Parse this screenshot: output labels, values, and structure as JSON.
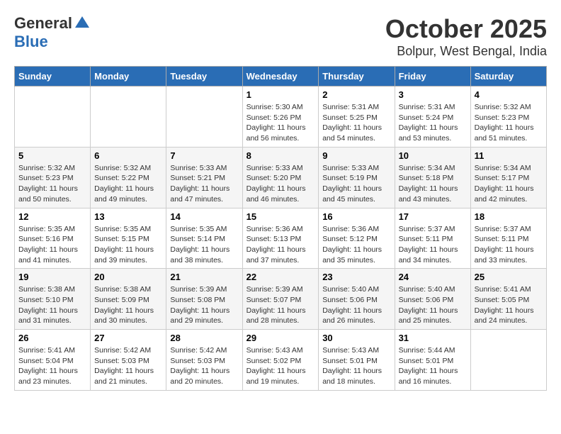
{
  "logo": {
    "general": "General",
    "blue": "Blue"
  },
  "title": {
    "month": "October 2025",
    "location": "Bolpur, West Bengal, India"
  },
  "headers": [
    "Sunday",
    "Monday",
    "Tuesday",
    "Wednesday",
    "Thursday",
    "Friday",
    "Saturday"
  ],
  "weeks": [
    [
      {
        "day": "",
        "info": ""
      },
      {
        "day": "",
        "info": ""
      },
      {
        "day": "",
        "info": ""
      },
      {
        "day": "1",
        "info": "Sunrise: 5:30 AM\nSunset: 5:26 PM\nDaylight: 11 hours\nand 56 minutes."
      },
      {
        "day": "2",
        "info": "Sunrise: 5:31 AM\nSunset: 5:25 PM\nDaylight: 11 hours\nand 54 minutes."
      },
      {
        "day": "3",
        "info": "Sunrise: 5:31 AM\nSunset: 5:24 PM\nDaylight: 11 hours\nand 53 minutes."
      },
      {
        "day": "4",
        "info": "Sunrise: 5:32 AM\nSunset: 5:23 PM\nDaylight: 11 hours\nand 51 minutes."
      }
    ],
    [
      {
        "day": "5",
        "info": "Sunrise: 5:32 AM\nSunset: 5:23 PM\nDaylight: 11 hours\nand 50 minutes."
      },
      {
        "day": "6",
        "info": "Sunrise: 5:32 AM\nSunset: 5:22 PM\nDaylight: 11 hours\nand 49 minutes."
      },
      {
        "day": "7",
        "info": "Sunrise: 5:33 AM\nSunset: 5:21 PM\nDaylight: 11 hours\nand 47 minutes."
      },
      {
        "day": "8",
        "info": "Sunrise: 5:33 AM\nSunset: 5:20 PM\nDaylight: 11 hours\nand 46 minutes."
      },
      {
        "day": "9",
        "info": "Sunrise: 5:33 AM\nSunset: 5:19 PM\nDaylight: 11 hours\nand 45 minutes."
      },
      {
        "day": "10",
        "info": "Sunrise: 5:34 AM\nSunset: 5:18 PM\nDaylight: 11 hours\nand 43 minutes."
      },
      {
        "day": "11",
        "info": "Sunrise: 5:34 AM\nSunset: 5:17 PM\nDaylight: 11 hours\nand 42 minutes."
      }
    ],
    [
      {
        "day": "12",
        "info": "Sunrise: 5:35 AM\nSunset: 5:16 PM\nDaylight: 11 hours\nand 41 minutes."
      },
      {
        "day": "13",
        "info": "Sunrise: 5:35 AM\nSunset: 5:15 PM\nDaylight: 11 hours\nand 39 minutes."
      },
      {
        "day": "14",
        "info": "Sunrise: 5:35 AM\nSunset: 5:14 PM\nDaylight: 11 hours\nand 38 minutes."
      },
      {
        "day": "15",
        "info": "Sunrise: 5:36 AM\nSunset: 5:13 PM\nDaylight: 11 hours\nand 37 minutes."
      },
      {
        "day": "16",
        "info": "Sunrise: 5:36 AM\nSunset: 5:12 PM\nDaylight: 11 hours\nand 35 minutes."
      },
      {
        "day": "17",
        "info": "Sunrise: 5:37 AM\nSunset: 5:11 PM\nDaylight: 11 hours\nand 34 minutes."
      },
      {
        "day": "18",
        "info": "Sunrise: 5:37 AM\nSunset: 5:11 PM\nDaylight: 11 hours\nand 33 minutes."
      }
    ],
    [
      {
        "day": "19",
        "info": "Sunrise: 5:38 AM\nSunset: 5:10 PM\nDaylight: 11 hours\nand 31 minutes."
      },
      {
        "day": "20",
        "info": "Sunrise: 5:38 AM\nSunset: 5:09 PM\nDaylight: 11 hours\nand 30 minutes."
      },
      {
        "day": "21",
        "info": "Sunrise: 5:39 AM\nSunset: 5:08 PM\nDaylight: 11 hours\nand 29 minutes."
      },
      {
        "day": "22",
        "info": "Sunrise: 5:39 AM\nSunset: 5:07 PM\nDaylight: 11 hours\nand 28 minutes."
      },
      {
        "day": "23",
        "info": "Sunrise: 5:40 AM\nSunset: 5:06 PM\nDaylight: 11 hours\nand 26 minutes."
      },
      {
        "day": "24",
        "info": "Sunrise: 5:40 AM\nSunset: 5:06 PM\nDaylight: 11 hours\nand 25 minutes."
      },
      {
        "day": "25",
        "info": "Sunrise: 5:41 AM\nSunset: 5:05 PM\nDaylight: 11 hours\nand 24 minutes."
      }
    ],
    [
      {
        "day": "26",
        "info": "Sunrise: 5:41 AM\nSunset: 5:04 PM\nDaylight: 11 hours\nand 23 minutes."
      },
      {
        "day": "27",
        "info": "Sunrise: 5:42 AM\nSunset: 5:03 PM\nDaylight: 11 hours\nand 21 minutes."
      },
      {
        "day": "28",
        "info": "Sunrise: 5:42 AM\nSunset: 5:03 PM\nDaylight: 11 hours\nand 20 minutes."
      },
      {
        "day": "29",
        "info": "Sunrise: 5:43 AM\nSunset: 5:02 PM\nDaylight: 11 hours\nand 19 minutes."
      },
      {
        "day": "30",
        "info": "Sunrise: 5:43 AM\nSunset: 5:01 PM\nDaylight: 11 hours\nand 18 minutes."
      },
      {
        "day": "31",
        "info": "Sunrise: 5:44 AM\nSunset: 5:01 PM\nDaylight: 11 hours\nand 16 minutes."
      },
      {
        "day": "",
        "info": ""
      }
    ]
  ]
}
